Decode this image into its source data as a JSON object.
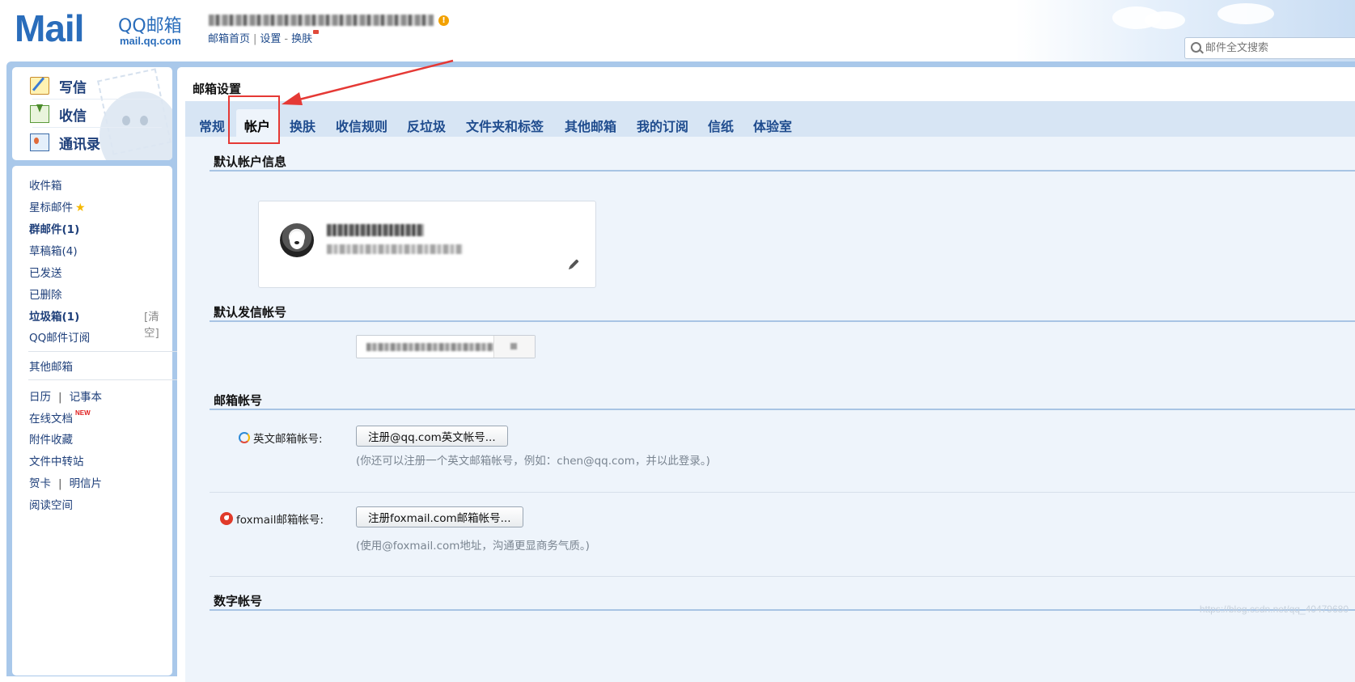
{
  "header": {
    "logo_text": "Mail",
    "logo_cn": "QQ邮箱",
    "logo_url": "mail.qq.com",
    "links": [
      "邮箱首页",
      "设置",
      "换肤"
    ],
    "search_placeholder": "邮件全文搜索"
  },
  "compose": {
    "items": [
      {
        "label": "写信",
        "icon": "write-icon"
      },
      {
        "label": "收信",
        "icon": "inbox-icon"
      },
      {
        "label": "通讯录",
        "icon": "contacts-icon"
      }
    ]
  },
  "folders": {
    "inbox": "收件箱",
    "starred": "星标邮件",
    "group": "群邮件(1)",
    "drafts": "草稿箱(4)",
    "sent": "已发送",
    "deleted": "已删除",
    "spam": "垃圾箱(1)",
    "spam_clear": "[清空]",
    "qq_subscribe": "QQ邮件订阅",
    "other_mailbox": "其他邮箱",
    "calendar": "日历",
    "notepad": "记事本",
    "online_docs": "在线文档",
    "online_docs_badge": "NEW",
    "attachments": "附件收藏",
    "file_transfer": "文件中转站",
    "greeting_card": "贺卡",
    "postcard": "明信片",
    "reading_space": "阅读空间",
    "pipe": "|"
  },
  "main": {
    "title": "邮箱设置",
    "tabs": [
      "常规",
      "帐户",
      "换肤",
      "收信规则",
      "反垃圾",
      "文件夹和标签",
      "其他邮箱",
      "我的订阅",
      "信纸",
      "体验室"
    ],
    "active_tab": "帐户",
    "sections": {
      "default_account": "默认帐户信息",
      "default_sender": "默认发信帐号",
      "mailbox_account": "邮箱帐号",
      "digital_account": "数字帐号"
    },
    "english_label": "英文邮箱帐号:",
    "english_button": "注册@qq.com英文帐号...",
    "english_hint": "(你还可以注册一个英文邮箱帐号，例如：chen@qq.com，并以此登录。)",
    "foxmail_label": "foxmail邮箱帐号:",
    "foxmail_button": "注册foxmail.com邮箱帐号...",
    "foxmail_hint": "(使用@foxmail.com地址，沟通更显商务气质。)"
  },
  "watermark": "https://blog.csdn.net/qq_40479680"
}
